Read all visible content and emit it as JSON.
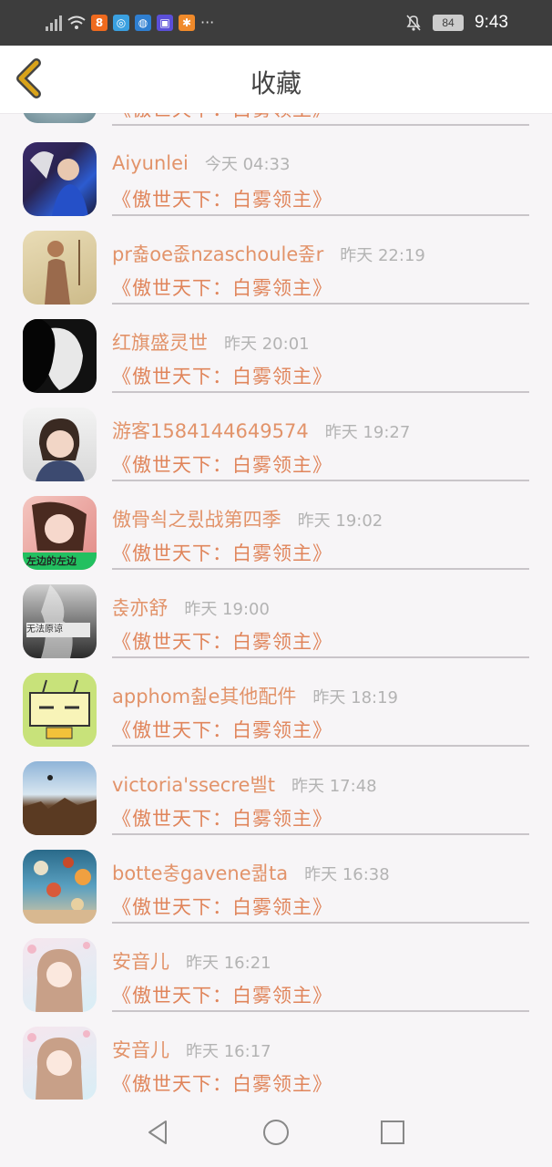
{
  "status_bar": {
    "battery": "84",
    "time": "9:43"
  },
  "header": {
    "title": "收藏"
  },
  "partial_row": {
    "book": "《傲世天下：白雾领主》"
  },
  "items": [
    {
      "name": "Aiyunlei",
      "time": "今天 04:33",
      "book": "《傲世天下：白雾领主》"
    },
    {
      "name": "pr춃oe좂nzaschoule좊r",
      "time": "昨天 22:19",
      "book": "《傲世天下：白雾领主》"
    },
    {
      "name": "红旗盛灵世",
      "time": "昨天 20:01",
      "book": "《傲世天下：白雾领主》"
    },
    {
      "name": "游客1584144649574",
      "time": "昨天 19:27",
      "book": "《傲世天下：白雾领主》"
    },
    {
      "name": "傲骨쇡之륐战第四季",
      "time": "昨天 19:02",
      "book": "《傲世天下：白雾领主》"
    },
    {
      "name": "춙亦舒",
      "time": "昨天 19:00",
      "book": "《傲世天下：白雾领主》"
    },
    {
      "name": "apphom췶e其他配件",
      "time": "昨天 18:19",
      "book": "《傲世天下：白雾领主》"
    },
    {
      "name": "victoria'ssecre벨t",
      "time": "昨天 17:48",
      "book": "《傲世天下：白雾领主》"
    },
    {
      "name": "botte충gavene퀆ta",
      "time": "昨天 16:38",
      "book": "《傲世天下：白雾领主》"
    },
    {
      "name": "安音儿",
      "time": "昨天 16:21",
      "book": "《傲世天下：白雾领主》"
    },
    {
      "name": "安音儿",
      "time": "昨天 16:17",
      "book": "《傲世天下：白雾领主》"
    }
  ],
  "avatar_captions": {
    "row5": "左边的左边",
    "row6": "无法原谅"
  },
  "colors": {
    "name": "#e2936a",
    "book": "#e0855b",
    "time": "#b3b3b3",
    "back_icon": "#d9a31a"
  }
}
